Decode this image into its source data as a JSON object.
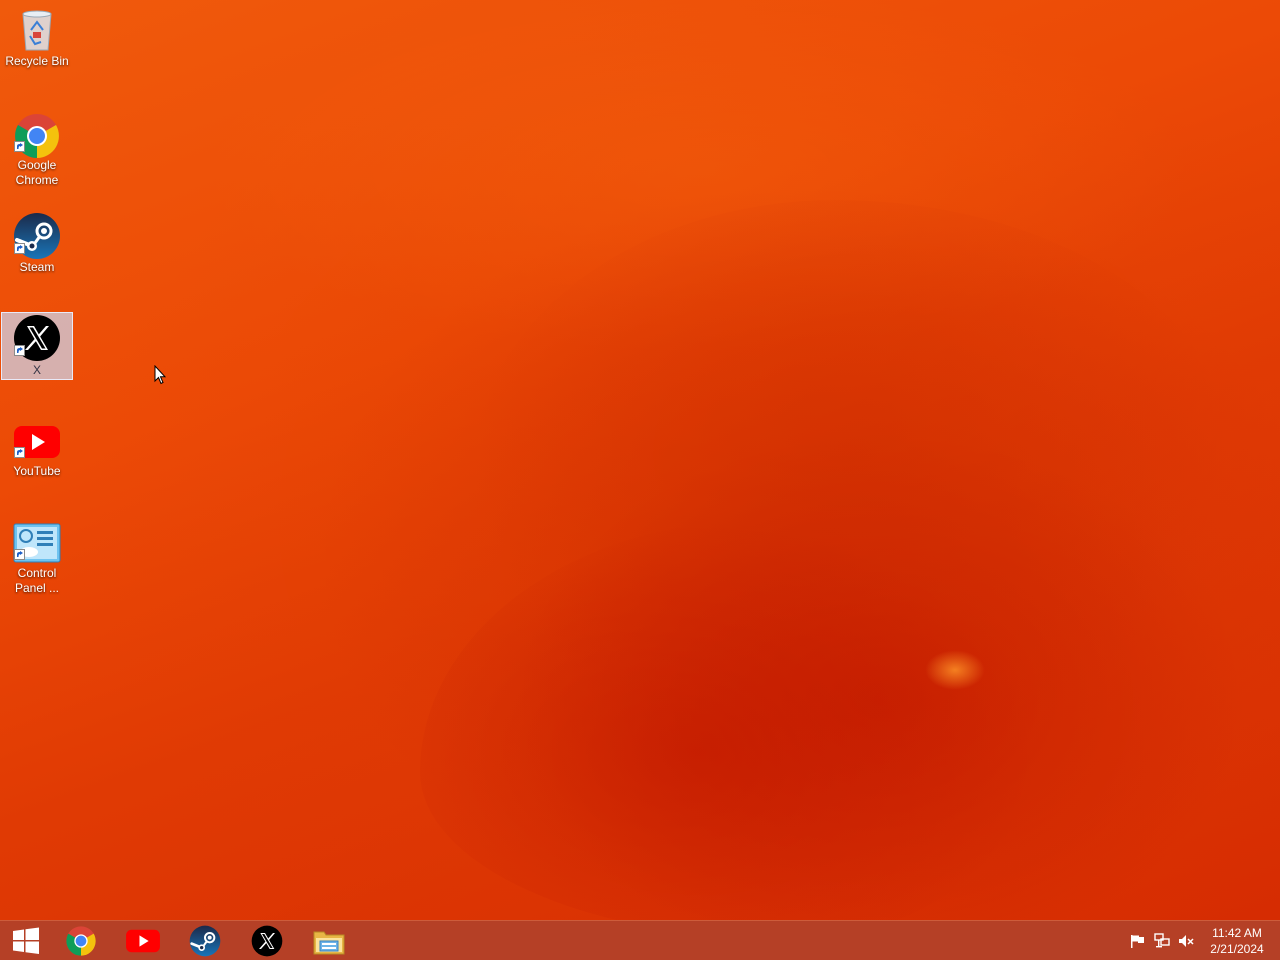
{
  "desktop": {
    "icons": [
      {
        "label": "Recycle Bin",
        "icon": "recycle-bin-icon",
        "selected": false
      },
      {
        "label": "Google\nChrome",
        "icon": "chrome-icon",
        "selected": false
      },
      {
        "label": "Steam",
        "icon": "steam-icon",
        "selected": false
      },
      {
        "label": "X",
        "icon": "x-icon",
        "selected": true
      },
      {
        "label": "YouTube",
        "icon": "youtube-icon",
        "selected": false
      },
      {
        "label": "Control\nPanel ...",
        "icon": "control-panel-icon",
        "selected": false
      }
    ]
  },
  "taskbar": {
    "start": {
      "icon": "windows-start-icon"
    },
    "pinned": [
      {
        "name": "Google Chrome",
        "icon": "chrome-icon"
      },
      {
        "name": "YouTube",
        "icon": "youtube-icon"
      },
      {
        "name": "Steam",
        "icon": "steam-icon"
      },
      {
        "name": "X",
        "icon": "x-icon"
      },
      {
        "name": "File Explorer",
        "icon": "file-explorer-icon"
      }
    ],
    "tray": {
      "icons": [
        "action-center-flag-icon",
        "network-icon",
        "volume-muted-icon"
      ],
      "time": "11:42 AM",
      "date": "2/21/2024"
    }
  },
  "colors": {
    "wallpaper_primary": "#ec4a06",
    "wallpaper_dark": "#c81a00",
    "taskbar": "#af3014",
    "selection": "#cdd7f0"
  }
}
